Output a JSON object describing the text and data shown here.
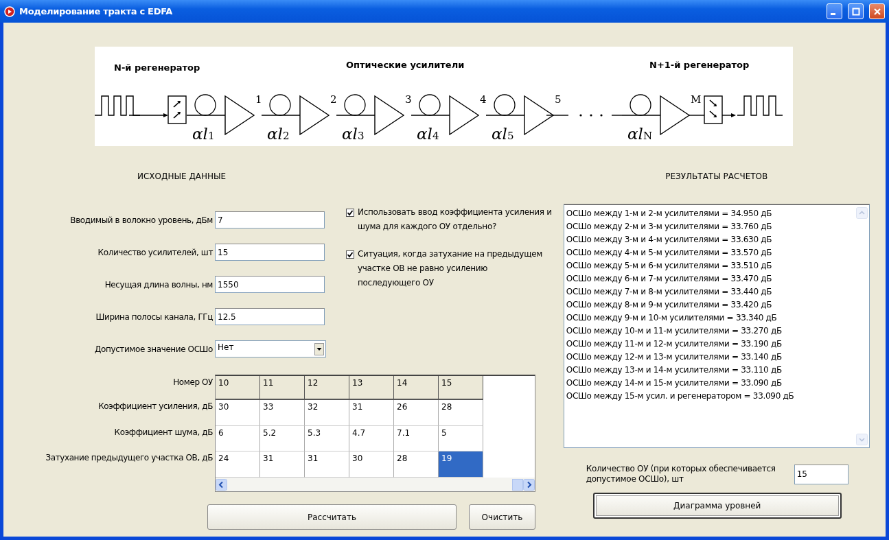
{
  "window": {
    "title": "Моделирование тракта с EDFA"
  },
  "diagram": {
    "left_label": "N-й регенератор",
    "center_label": "Оптические усилители",
    "right_label": "N+1-й регенератор",
    "spans": [
      {
        "fiber": "αl",
        "index": "1",
        "amplifier": "1"
      },
      {
        "fiber": "αl",
        "index": "2",
        "amplifier": "2"
      },
      {
        "fiber": "αl",
        "index": "3",
        "amplifier": "3"
      },
      {
        "fiber": "αl",
        "index": "4",
        "amplifier": "4"
      },
      {
        "fiber": "αl",
        "index": "5",
        "amplifier": "5"
      }
    ],
    "last_span": {
      "fiber": "αl",
      "index": "N",
      "amplifier": "M"
    }
  },
  "input_section": {
    "title": "ИСХОДНЫЕ ДАННЫЕ",
    "fields": [
      {
        "kind": "text",
        "label": "Вводимый в волокно уровень, дБм",
        "value": "7"
      },
      {
        "kind": "text",
        "label": "Количество усилителей, шт",
        "value": "15"
      },
      {
        "kind": "text",
        "label": "Несущая длина волны, нм",
        "value": "1550"
      },
      {
        "kind": "text",
        "label": "Ширина полосы канала, ГГц",
        "value": "12.5"
      },
      {
        "kind": "dropdown",
        "label": "Допустимое значение ОСШо",
        "value": "Нет"
      }
    ],
    "checkboxes": [
      {
        "label": "Использовать ввод коэффициента усиления и шума для каждого ОУ отдельно?",
        "checked": true
      },
      {
        "label": "Ситуация, когда затухание на предыдущем участке ОВ не равно усилению последующего ОУ",
        "checked": true
      }
    ],
    "grid": {
      "header_label": "Номер ОУ",
      "header": [
        "10",
        "11",
        "12",
        "13",
        "14",
        "15"
      ],
      "rows": [
        {
          "label": "Коэффициент усиления, дБ",
          "cells": [
            {
              "text": "30",
              "selected": false
            },
            {
              "text": "33",
              "selected": false
            },
            {
              "text": "32",
              "selected": false
            },
            {
              "text": "31",
              "selected": false
            },
            {
              "text": "26",
              "selected": false
            },
            {
              "text": "28",
              "selected": false
            }
          ]
        },
        {
          "label": "Коэффициент шума, дБ",
          "cells": [
            {
              "text": "6",
              "selected": false
            },
            {
              "text": "5.2",
              "selected": false
            },
            {
              "text": "5.3",
              "selected": false
            },
            {
              "text": "4.7",
              "selected": false
            },
            {
              "text": "7.1",
              "selected": false
            },
            {
              "text": "5",
              "selected": false
            }
          ]
        },
        {
          "label": "Затухание предыдущего участка ОВ, дБ",
          "cells": [
            {
              "text": "24",
              "selected": false
            },
            {
              "text": "31",
              "selected": false
            },
            {
              "text": "31",
              "selected": false
            },
            {
              "text": "30",
              "selected": false
            },
            {
              "text": "28",
              "selected": false
            },
            {
              "text": "19",
              "selected": true
            }
          ]
        }
      ]
    },
    "buttons": [
      "Рассчитать",
      "Очистить"
    ]
  },
  "results_section": {
    "title": "РЕЗУЛЬТАТЫ РАСЧЕТОВ",
    "results": [
      "ОСШо между 1-м и 2-м усилителями = 34.950 дБ",
      "ОСШо между 2-м и 3-м усилителями = 33.760 дБ",
      "ОСШо между 3-м и 4-м усилителями = 33.630 дБ",
      "ОСШо между 4-м и 5-м усилителями = 33.570 дБ",
      "ОСШо между 5-м и 6-м усилителями = 33.510 дБ",
      "ОСШо между 6-м и 7-м усилителями = 33.470 дБ",
      "ОСШо между 7-м и 8-м усилителями = 33.440 дБ",
      "ОСШо между 8-м и 9-м усилителями = 33.420 дБ",
      "ОСШо между 9-м и 10-м усилителями = 33.340 дБ",
      "ОСШо между 10-м и 11-м усилителями = 33.270 дБ",
      "ОСШо между 11-м и 12-м усилителями = 33.190 дБ",
      "ОСШо между 12-м и 13-м усилителями = 33.140 дБ",
      "ОСШо между 13-м и 14-м усилителями = 33.110 дБ",
      "ОСШо между 14-м и 15-м усилителями = 33.090 дБ",
      "ОСШо между 15-м усил. и регенератором = 33.090 дБ"
    ],
    "count_field": {
      "label": "Количество ОУ (при которых обеспечивается допустимое ОСШо), шт",
      "value": "15"
    },
    "button": "Диаграмма уровней"
  }
}
